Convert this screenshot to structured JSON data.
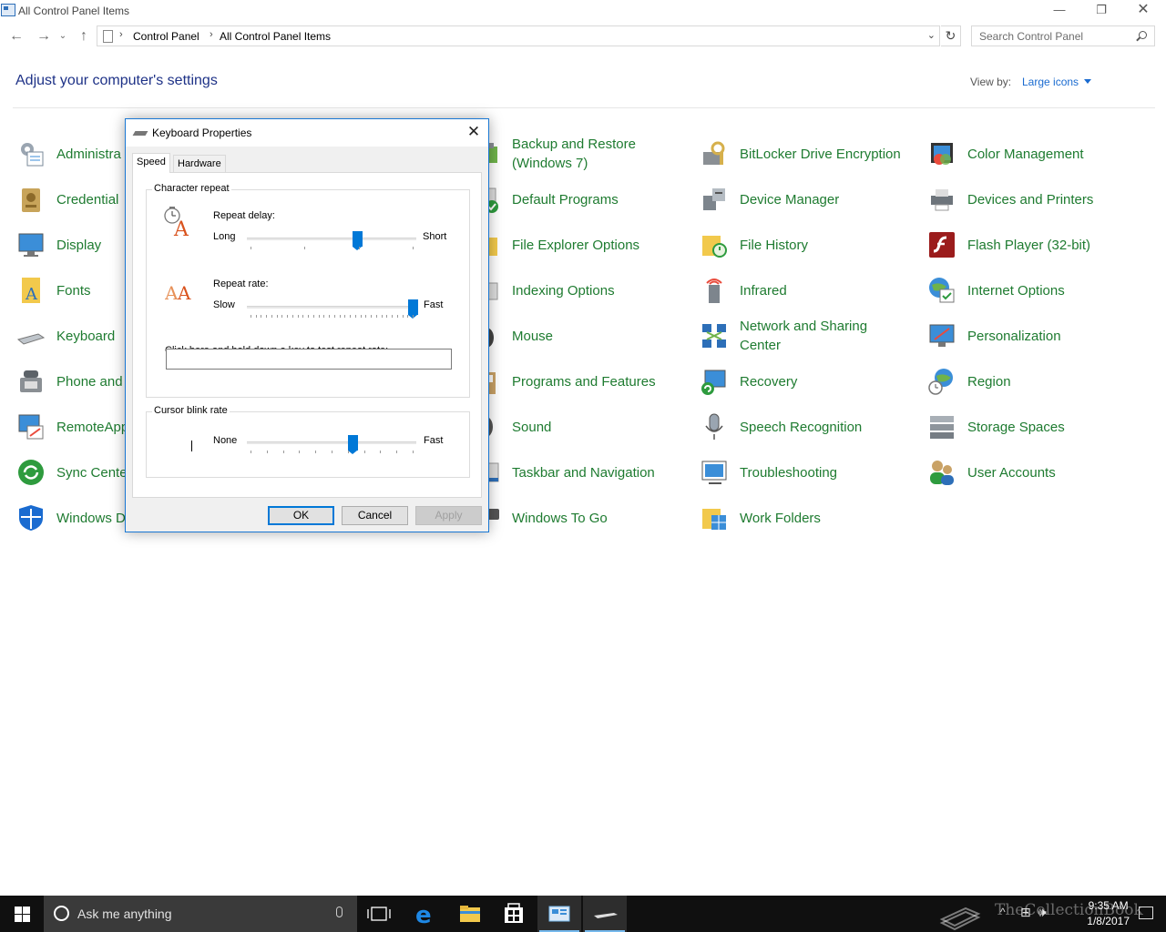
{
  "window": {
    "title": "All Control Panel Items",
    "minimize": "—",
    "maximize": "❐",
    "close": "✕"
  },
  "address": {
    "crumbs": [
      "Control Panel",
      "All Control Panel Items"
    ],
    "separator": "›",
    "search_placeholder": "Search Control Panel"
  },
  "header": {
    "title": "Adjust your computer's settings",
    "view_by_label": "View by:",
    "view_by_value": "Large icons"
  },
  "items": [
    {
      "label": "Administra",
      "icon": "administrative-tools-icon"
    },
    {
      "label": "Backup and Restore (Windows 7)",
      "icon": "backup-restore-icon"
    },
    {
      "label": "BitLocker Drive Encryption",
      "icon": "bitlocker-icon"
    },
    {
      "label": "Color Management",
      "icon": "color-management-icon"
    },
    {
      "label": "Credential",
      "icon": "credential-manager-icon"
    },
    {
      "label": "Default Programs",
      "icon": "default-programs-icon"
    },
    {
      "label": "Device Manager",
      "icon": "device-manager-icon"
    },
    {
      "label": "Devices and Printers",
      "icon": "devices-printers-icon"
    },
    {
      "label": "Display",
      "icon": "display-icon"
    },
    {
      "label": "File Explorer Options",
      "icon": "file-explorer-options-icon"
    },
    {
      "label": "File History",
      "icon": "file-history-icon"
    },
    {
      "label": "Flash Player (32-bit)",
      "icon": "flash-player-icon"
    },
    {
      "label": "Fonts",
      "icon": "fonts-icon"
    },
    {
      "label": "Indexing Options",
      "icon": "indexing-options-icon"
    },
    {
      "label": "Infrared",
      "icon": "infrared-icon"
    },
    {
      "label": "Internet Options",
      "icon": "internet-options-icon"
    },
    {
      "label": "Keyboard",
      "icon": "keyboard-icon"
    },
    {
      "label": "Mouse",
      "icon": "mouse-icon"
    },
    {
      "label": "Network and Sharing Center",
      "icon": "network-sharing-icon"
    },
    {
      "label": "Personalization",
      "icon": "personalization-icon"
    },
    {
      "label": "Phone and",
      "icon": "phone-modem-icon"
    },
    {
      "label": "Programs and Features",
      "icon": "programs-features-icon"
    },
    {
      "label": "Recovery",
      "icon": "recovery-icon"
    },
    {
      "label": "Region",
      "icon": "region-icon"
    },
    {
      "label": "RemoteApp Connection",
      "icon": "remoteapp-icon"
    },
    {
      "label": "Sound",
      "icon": "sound-icon"
    },
    {
      "label": "Speech Recognition",
      "icon": "speech-recognition-icon"
    },
    {
      "label": "Storage Spaces",
      "icon": "storage-spaces-icon"
    },
    {
      "label": "Sync Cente",
      "icon": "sync-center-icon"
    },
    {
      "label": "Taskbar and Navigation",
      "icon": "taskbar-navigation-icon"
    },
    {
      "label": "Troubleshooting",
      "icon": "troubleshooting-icon"
    },
    {
      "label": "User Accounts",
      "icon": "user-accounts-icon"
    },
    {
      "label": "Windows D",
      "icon": "windows-defender-icon"
    },
    {
      "label": "Windows To Go",
      "icon": "windows-to-go-icon"
    },
    {
      "label": "Work Folders",
      "icon": "work-folders-icon"
    }
  ],
  "dialog": {
    "title": "Keyboard Properties",
    "close": "✕",
    "tabs": [
      "Speed",
      "Hardware"
    ],
    "character_repeat": {
      "title": "Character repeat",
      "repeat_delay": {
        "label": "Repeat delay:",
        "min": "Long",
        "max": "Short",
        "value": 0.66,
        "ticks": 4
      },
      "repeat_rate": {
        "label": "Repeat rate:",
        "min": "Slow",
        "max": "Fast",
        "value": 1.0,
        "ticks": 32
      },
      "test_label": "Click here and hold down a key to test repeat rate:",
      "test_value": ""
    },
    "cursor_blink": {
      "title": "Cursor blink rate",
      "min": "None",
      "max": "Fast",
      "value": 0.63,
      "ticks": 11
    },
    "buttons": {
      "ok": "OK",
      "cancel": "Cancel",
      "apply": "Apply"
    }
  },
  "taskbar": {
    "search_text": "Ask me anything",
    "time": "9:35 AM",
    "date": "1/8/2017",
    "watermark": "TheCollectionBook"
  }
}
